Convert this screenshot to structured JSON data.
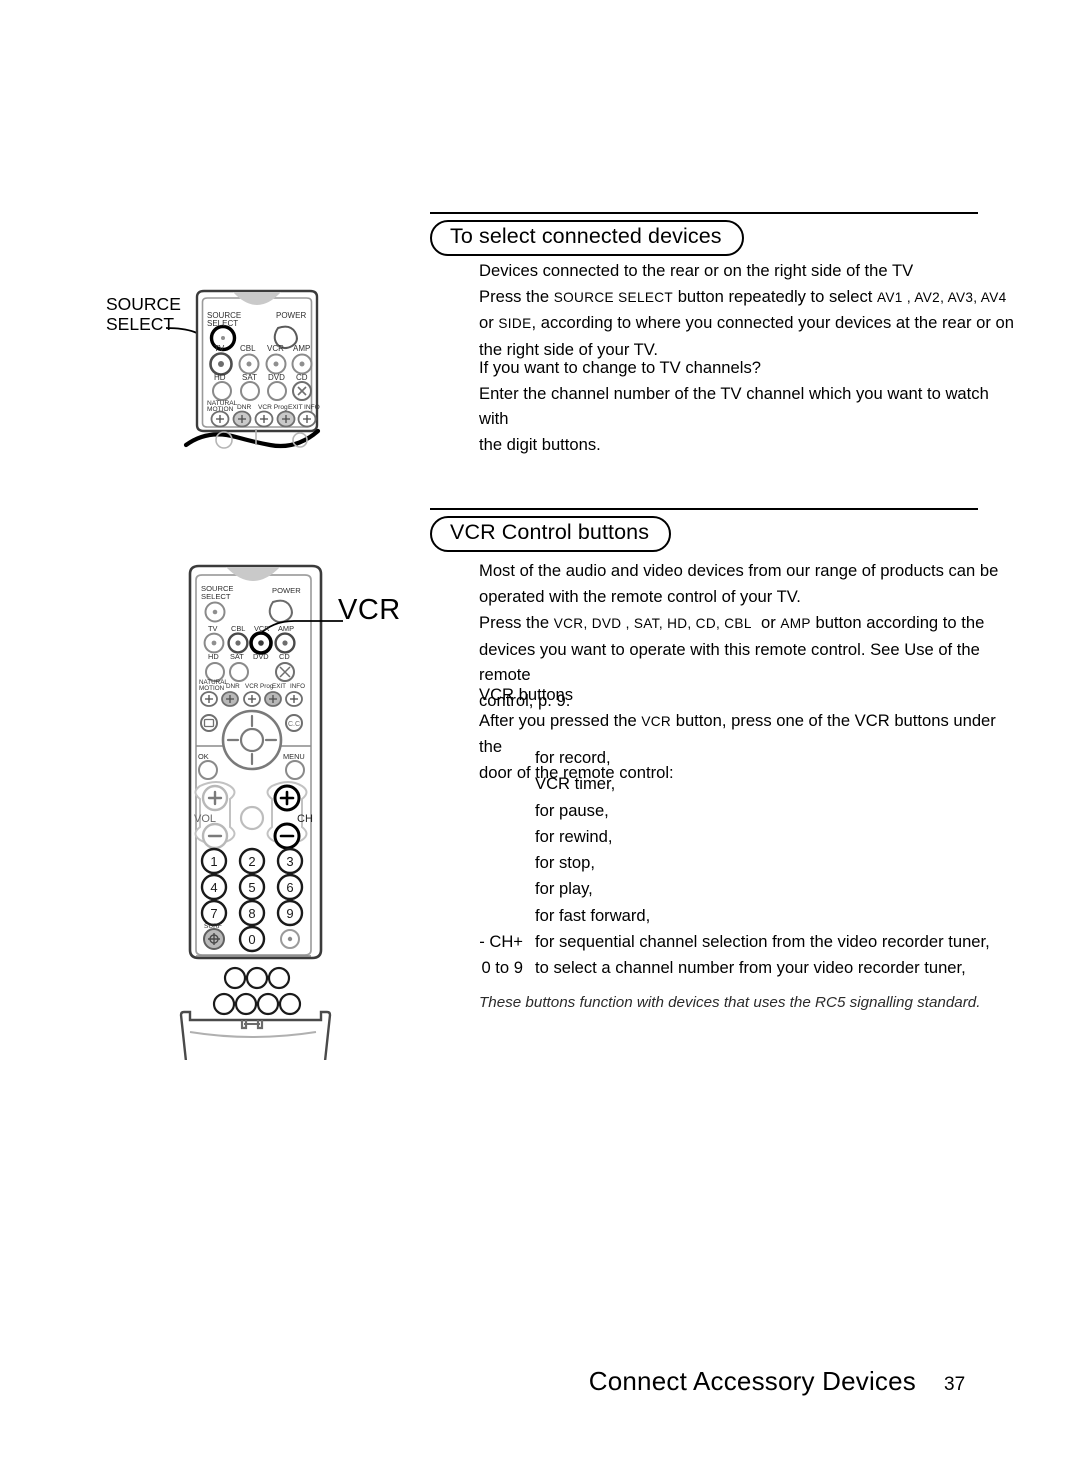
{
  "document": {
    "footer_title": "Connect Accessory Devices",
    "page_number": "37"
  },
  "sections": [
    {
      "id": "select-connected-devices",
      "heading": "To select connected devices",
      "paragraphs": [
        {
          "id": "para-1",
          "runs": [
            {
              "text": "Devices connected to the rear or on the right side of the TV\n",
              "style": "normal"
            },
            {
              "text": "Press the ",
              "style": "normal"
            },
            {
              "text": "SOURCE SELECT",
              "style": "mono"
            },
            {
              "text": " button repeatedly to select ",
              "style": "normal"
            },
            {
              "text": "AV1 , AV2, AV3, AV4",
              "style": "mono"
            },
            {
              "text": "\nor ",
              "style": "normal"
            },
            {
              "text": "SIDE",
              "style": "mono"
            },
            {
              "text": ", according to where you connected your devices at the rear or on\nthe right side of your TV.",
              "style": "normal"
            }
          ]
        },
        {
          "id": "para-2",
          "runs": [
            {
              "text": "If you want to change to TV channels?\nEnter the channel number of the TV channel which you want to watch with\nthe digit buttons.",
              "style": "normal"
            }
          ]
        }
      ]
    },
    {
      "id": "vcr-control-buttons",
      "heading": "VCR Control buttons",
      "paragraphs": [
        {
          "id": "para-3",
          "runs": [
            {
              "text": "Most of the audio and video devices from our range of products can be\noperated with the remote control of your TV.",
              "style": "normal"
            }
          ]
        },
        {
          "id": "para-4",
          "runs": [
            {
              "text": "Press the ",
              "style": "normal"
            },
            {
              "text": "VCR, DVD , SAT, HD, CD, CBL",
              "style": "mono"
            },
            {
              "text": "  or ",
              "style": "normal"
            },
            {
              "text": "AMP",
              "style": "mono"
            },
            {
              "text": " button according to the\ndevices you want to operate with this remote control. See Use of the remote\ncontrol, p. 9.",
              "style": "normal"
            }
          ]
        },
        {
          "id": "para-5",
          "runs": [
            {
              "text": "VCR buttons\nAfter you pressed the ",
              "style": "normal"
            },
            {
              "text": "VCR",
              "style": "mono"
            },
            {
              "text": " button, press one of the VCR buttons under the\ndoor of the remote control:",
              "style": "normal"
            }
          ]
        }
      ]
    }
  ],
  "vcr_functions": [
    {
      "key": "",
      "icon": "record-icon",
      "description": "for record,"
    },
    {
      "key": "",
      "icon": "timer-icon",
      "description": "VCR timer,"
    },
    {
      "key": "",
      "icon": "pause-icon",
      "description": "for pause,"
    },
    {
      "key": "",
      "icon": "rewind-icon",
      "description": "for rewind,"
    },
    {
      "key": "",
      "icon": "stop-icon",
      "description": "for stop,"
    },
    {
      "key": "",
      "icon": "play-icon",
      "description": "for play,"
    },
    {
      "key": "",
      "icon": "fast-forward-icon",
      "description": "for fast forward,"
    },
    {
      "key": "- CH+",
      "icon": "",
      "description": "for sequential channel selection from the video recorder tuner,"
    },
    {
      "key": "0 to 9",
      "icon": "",
      "description": "to select a channel number from your video recorder tuner,"
    }
  ],
  "footnote": "These buttons function with devices that uses the RC5 signalling standard.",
  "illustrations": {
    "top_remote": {
      "callout_label_line1": "SOURCE",
      "callout_label_line2": "SELECT",
      "buttons_row0": [
        "SOURCE\nSELECT",
        "POWER"
      ],
      "buttons_row1_labels": [
        "TV",
        "CBL",
        "VCR",
        "AMP"
      ],
      "buttons_row2_labels": [
        "HD",
        "SAT",
        "DVD",
        "CD"
      ],
      "buttons_row3_labels": [
        "NATURAL\nMOTION",
        "DNR",
        "VCR Prog",
        "EXIT",
        "INFO"
      ]
    },
    "bottom_remote": {
      "callout_label": "VCR",
      "labels": {
        "source_select": "SOURCE\nSELECT",
        "power": "POWER",
        "row1": [
          "TV",
          "CBL",
          "VCR",
          "AMP"
        ],
        "row2": [
          "HD",
          "SAT",
          "DVD",
          "CD"
        ],
        "row3": [
          "NATURAL\nMOTION",
          "DNR",
          "VCR Prog",
          "EXIT",
          "INFO"
        ],
        "ok": "OK",
        "menu": "MENU",
        "vol": "VOL",
        "ch": "CH",
        "surf": "SURF"
      },
      "keypad": [
        "1",
        "2",
        "3",
        "4",
        "5",
        "6",
        "7",
        "8",
        "9",
        "0"
      ]
    }
  },
  "colors": {
    "ink": "#000000",
    "paper": "#ffffff",
    "illustration_line": "#8c8c8c",
    "illustration_fill": "#d4d4d4",
    "note_text": "#2b2b2b"
  }
}
